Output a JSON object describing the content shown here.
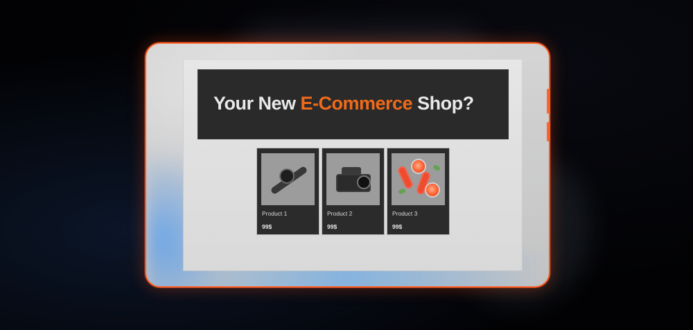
{
  "hero": {
    "prefix": "Your New ",
    "accent": "E-Commerce",
    "suffix": " Shop?"
  },
  "products": [
    {
      "name": "Product 1",
      "price": "99$",
      "image_icon": "smartwatch-icon"
    },
    {
      "name": "Product 2",
      "price": "99$",
      "image_icon": "instant-camera-icon"
    },
    {
      "name": "Product 3",
      "price": "99$",
      "image_icon": "juice-bottles-icon"
    }
  ],
  "colors": {
    "accent_orange": "#F06A1A",
    "frame_orange": "#FF5A1F",
    "hero_bg": "#2A2A2A",
    "card_bg": "#2B2B2B"
  }
}
